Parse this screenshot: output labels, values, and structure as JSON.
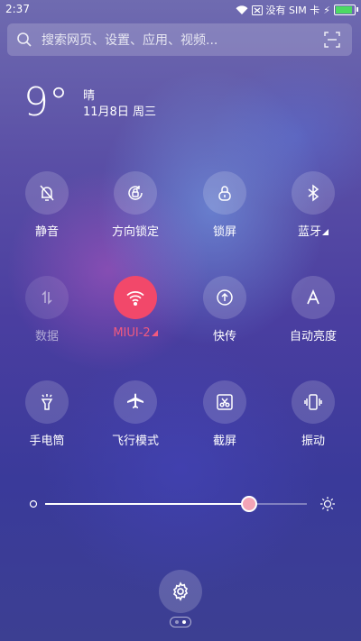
{
  "status": {
    "time": "2:37",
    "sim_text": "没有 SIM 卡",
    "battery_level": 0.9,
    "battery_color": "#4cd964"
  },
  "search": {
    "placeholder": "搜索网页、设置、应用、视频...",
    "icons": [
      "search-icon",
      "scan-icon"
    ]
  },
  "weather": {
    "temp": "9°",
    "condition": "晴",
    "date": "11月8日 周三"
  },
  "toggles": [
    {
      "label": "静音",
      "icon": "mute-bell-icon",
      "state": "off"
    },
    {
      "label": "方向锁定",
      "icon": "rotation-lock-icon",
      "state": "off"
    },
    {
      "label": "锁屏",
      "icon": "lock-icon",
      "state": "off"
    },
    {
      "label": "蓝牙",
      "icon": "bluetooth-icon",
      "state": "off",
      "has_more": true
    },
    {
      "label": "数据",
      "icon": "mobile-data-icon",
      "state": "disabled"
    },
    {
      "label": "MIUI-2",
      "icon": "wifi-icon",
      "state": "on",
      "has_more": true
    },
    {
      "label": "快传",
      "icon": "quick-transfer-icon",
      "state": "off"
    },
    {
      "label": "自动亮度",
      "icon": "auto-brightness-icon",
      "state": "off"
    },
    {
      "label": "手电筒",
      "icon": "flashlight-icon",
      "state": "off"
    },
    {
      "label": "飞行模式",
      "icon": "airplane-icon",
      "state": "off"
    },
    {
      "label": "截屏",
      "icon": "screenshot-icon",
      "state": "off"
    },
    {
      "label": "振动",
      "icon": "vibrate-icon",
      "state": "off"
    }
  ],
  "brightness": {
    "level": 0.78,
    "thumb_color": "#f3a4b6"
  },
  "accent_color": "#f2486a",
  "settings": {
    "icon": "gear-icon"
  },
  "pager": {
    "pages": 2,
    "current": 2
  }
}
